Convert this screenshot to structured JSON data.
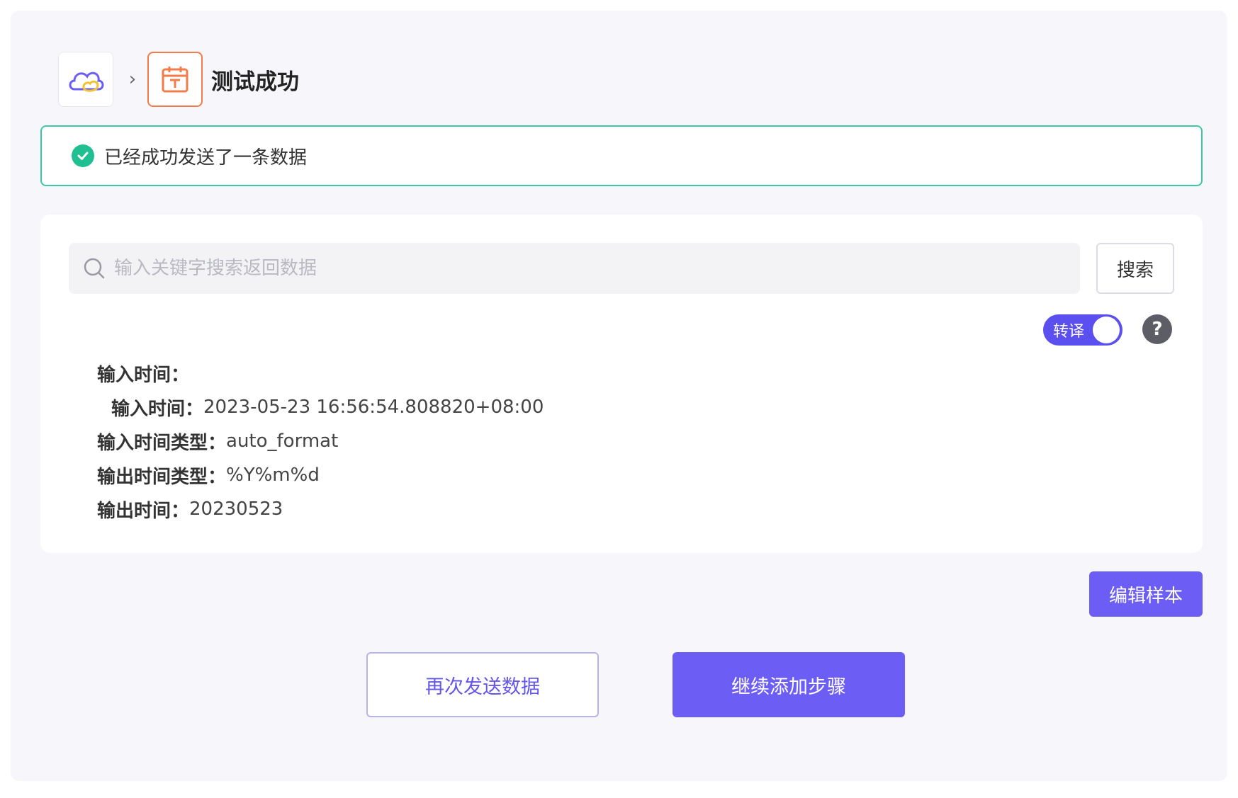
{
  "breadcrumb": {
    "app_icon": "cloud-icon",
    "step_icon": "calendar-icon",
    "separator_icon": "chevron-right-icon",
    "title": "测试成功"
  },
  "alert": {
    "icon": "check-circle-icon",
    "message": "已经成功发送了一条数据",
    "color": "#3cc8a4"
  },
  "search": {
    "icon": "search-icon",
    "placeholder": "输入关键字搜索返回数据",
    "value": "",
    "button_label": "搜索"
  },
  "toggle": {
    "label": "转译",
    "on": true,
    "color": "#5b4ff0"
  },
  "help": {
    "icon": "question-icon",
    "symbol": "?"
  },
  "data_fields": [
    {
      "key": "输入时间：",
      "value": "",
      "indent": false
    },
    {
      "key": "输入时间：",
      "value": "2023-05-23 16:56:54.808820+08:00",
      "indent": true
    },
    {
      "key": "输入时间类型：",
      "value": "auto_format",
      "indent": false
    },
    {
      "key": "输出时间类型：",
      "value": "%Y%m%d",
      "indent": false
    },
    {
      "key": "输出时间：",
      "value": "20230523",
      "indent": false
    }
  ],
  "actions": {
    "edit_sample": "编辑样本",
    "resend": "再次发送数据",
    "continue": "继续添加步骤"
  },
  "colors": {
    "primary": "#6c5ef5",
    "step_border": "#f27b4a"
  }
}
